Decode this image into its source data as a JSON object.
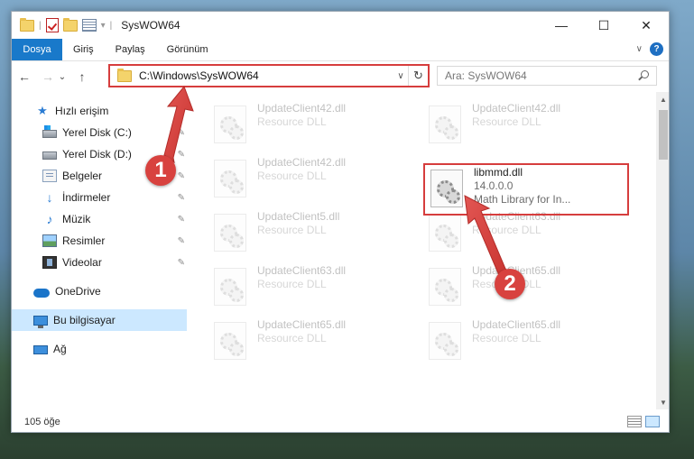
{
  "window": {
    "title": "SysWOW64",
    "controls": {
      "minimize": "—",
      "maximize": "☐",
      "close": "✕"
    }
  },
  "ribbon": {
    "tabs": [
      "Dosya",
      "Giriş",
      "Paylaş",
      "Görünüm"
    ],
    "collapse_glyph": "∨",
    "help_glyph": "?"
  },
  "navigation": {
    "back": "←",
    "forward": "→",
    "recent": "⌄",
    "up": "↑",
    "address": "C:\\Windows\\SysWOW64",
    "address_dropdown": "∨",
    "refresh": "↻",
    "search_placeholder": "Ara: SysWOW64"
  },
  "sidebar": {
    "quick_access": {
      "label": "Hızlı erişim",
      "icon": "star-icon"
    },
    "items": [
      {
        "label": "Yerel Disk (C:)",
        "icon": "windows-drive-icon",
        "pinned": true
      },
      {
        "label": "Yerel Disk (D:)",
        "icon": "drive-icon",
        "pinned": true
      },
      {
        "label": "Belgeler",
        "icon": "documents-icon",
        "pinned": true
      },
      {
        "label": "İndirmeler",
        "icon": "download-icon",
        "pinned": true
      },
      {
        "label": "Müzik",
        "icon": "music-icon",
        "pinned": true
      },
      {
        "label": "Resimler",
        "icon": "pictures-icon",
        "pinned": true
      },
      {
        "label": "Videolar",
        "icon": "videos-icon",
        "pinned": true
      }
    ],
    "onedrive": {
      "label": "OneDrive",
      "icon": "cloud-icon"
    },
    "this_pc": {
      "label": "Bu bilgisayar",
      "icon": "computer-icon"
    },
    "network": {
      "label": "Ağ",
      "icon": "network-icon"
    },
    "pin_glyph": "📌"
  },
  "files": {
    "ghost": [
      {
        "name": "UpdateClient42.dll",
        "desc": "Resource DLL"
      },
      {
        "name": "UpdateClient42.dll",
        "desc": "Resource DLL"
      },
      {
        "name": "UpdateClient42.dll",
        "desc": "Resource DLL"
      },
      {
        "name": "UpdateClient5.dll",
        "desc": "Resource DLL"
      },
      {
        "name": "UpdateClient63.dll",
        "desc": "Resource DLL"
      },
      {
        "name": "UpdateClient63.dll",
        "desc": "Resource DLL"
      },
      {
        "name": "UpdateClient65.dll",
        "desc": "Resource DLL"
      },
      {
        "name": "UpdateClient65.dll",
        "desc": "Resource DLL"
      },
      {
        "name": "UpdateClient65.dll",
        "desc": "Resource DLL"
      }
    ],
    "highlighted": {
      "name": "libmmd.dll",
      "version": "14.0.0.0",
      "desc": "Math Library for In..."
    }
  },
  "status": {
    "item_count": "105 öğe"
  },
  "annotations": {
    "step1": "1",
    "step2": "2",
    "color": "#d63d3d"
  },
  "colors": {
    "accent": "#1979ca",
    "selection": "#cce8ff",
    "highlight": "#d63d3d"
  }
}
